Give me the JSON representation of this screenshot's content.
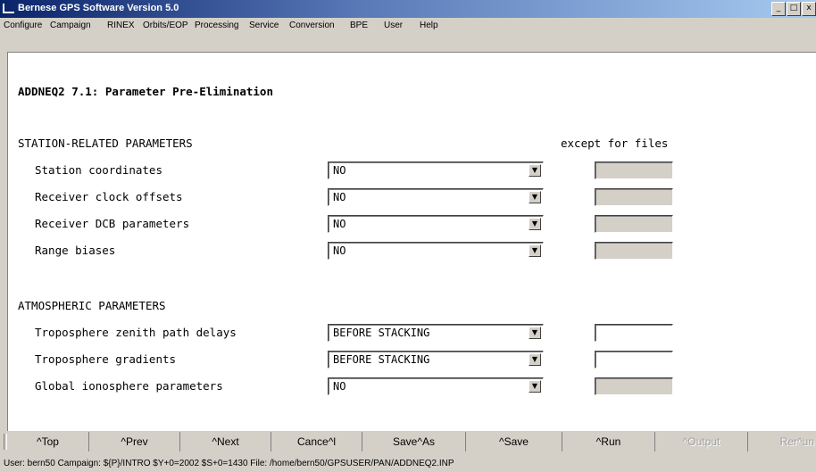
{
  "window": {
    "title": "Bernese GPS Software Version 5.0",
    "controls": [
      "_",
      "□",
      "x"
    ]
  },
  "menu": [
    "Configure",
    "Campaign",
    "RINEX",
    "Orbits/EOP",
    "Processing",
    "Service",
    "Conversion",
    "BPE",
    "User",
    "Help"
  ],
  "panel": {
    "title": "ADDNEQ2 7.1: Parameter Pre-Elimination",
    "station_section": "STATION-RELATED PARAMETERS",
    "except_label": "except for files",
    "station_rows": [
      {
        "label": "Station coordinates",
        "value": "NO"
      },
      {
        "label": "Receiver clock offsets",
        "value": "NO"
      },
      {
        "label": "Receiver DCB parameters",
        "value": "NO"
      },
      {
        "label": "Range biases",
        "value": "NO"
      }
    ],
    "atmo_section": "ATMOSPHERIC PARAMETERS",
    "atmo_rows": [
      {
        "label": "Troposphere zenith path delays",
        "value": "BEFORE STACKING"
      },
      {
        "label": "Troposphere gradients",
        "value": "BEFORE STACKING"
      },
      {
        "label": "Global ionosphere parameters",
        "value": "NO"
      }
    ]
  },
  "buttons": [
    "^Top",
    "^Prev",
    "^Next",
    "Cance^l",
    "Save^As",
    "^Save",
    "^Run",
    "^Output",
    "Rer^un"
  ],
  "status": "User: bern50  Campaign: ${P}/INTRO  $Y+0=2002  $S+0=1430  File: /home/bern50/GPSUSER/PAN/ADDNEQ2.INP"
}
